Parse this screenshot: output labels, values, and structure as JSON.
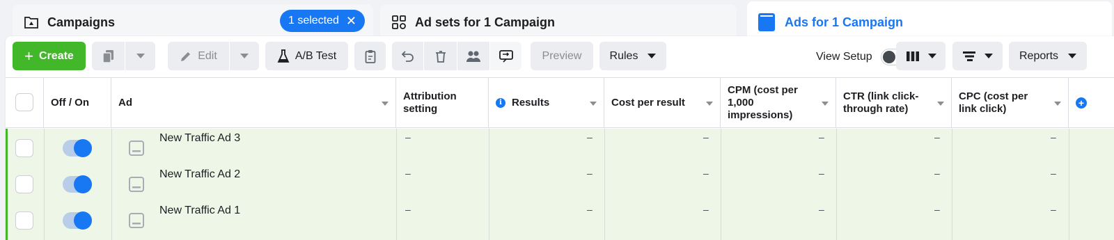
{
  "tabs": {
    "campaigns": {
      "label": "Campaigns",
      "selected_badge": "1 selected"
    },
    "adsets": {
      "label": "Ad sets for 1 Campaign"
    },
    "ads": {
      "label": "Ads for 1 Campaign",
      "active": true
    }
  },
  "toolbar": {
    "create_label": "Create",
    "edit_label": "Edit",
    "ab_test_label": "A/B Test",
    "preview_label": "Preview",
    "rules_label": "Rules",
    "view_setup_label": "View Setup",
    "view_setup_on": false,
    "reports_label": "Reports"
  },
  "table": {
    "columns": [
      {
        "key": "off_on",
        "label": "Off / On"
      },
      {
        "key": "ad",
        "label": "Ad"
      },
      {
        "key": "attribution",
        "label": "Attribution setting"
      },
      {
        "key": "results",
        "label": "Results"
      },
      {
        "key": "cost_per_result",
        "label": "Cost per result"
      },
      {
        "key": "cpm",
        "label": "CPM (cost per 1,000 impressions)"
      },
      {
        "key": "ctr",
        "label": "CTR (link click-through rate)"
      },
      {
        "key": "cpc",
        "label": "CPC (cost per link click)"
      }
    ],
    "rows": [
      {
        "name": "New Traffic Ad 3",
        "on": true,
        "attribution": "–",
        "results": "–",
        "cost_per_result": "–",
        "cpm": "–",
        "ctr": "–",
        "cpc": "–"
      },
      {
        "name": "New Traffic Ad 2",
        "on": true,
        "attribution": "–",
        "results": "–",
        "cost_per_result": "–",
        "cpm": "–",
        "ctr": "–",
        "cpc": "–"
      },
      {
        "name": "New Traffic Ad 1",
        "on": true,
        "attribution": "–",
        "results": "–",
        "cost_per_result": "–",
        "cpm": "–",
        "ctr": "–",
        "cpc": "–"
      }
    ]
  },
  "colors": {
    "accent": "#1877f2",
    "create_green": "#42b72a",
    "row_highlight": "#eef6e7"
  }
}
